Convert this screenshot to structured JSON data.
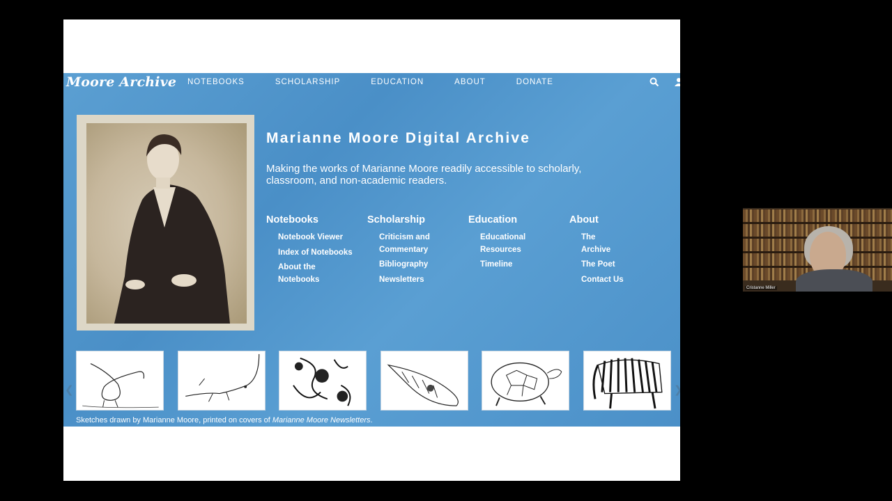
{
  "site": {
    "logo": "Moore Archive",
    "nav": [
      "NOTEBOOKS",
      "SCHOLARSHIP",
      "EDUCATION",
      "ABOUT",
      "DONATE"
    ],
    "icons": [
      "search-icon",
      "user-icon"
    ]
  },
  "hero": {
    "title": "Marianne Moore Digital Archive",
    "subtitle": "Making the works of Marianne Moore readily accessible to scholarly, classroom, and non-academic readers."
  },
  "columns": [
    {
      "heading": "Notebooks",
      "links": [
        "Notebook Viewer",
        "Index of Notebooks",
        "About the Notebooks"
      ]
    },
    {
      "heading": "Scholarship",
      "links": [
        "Criticism and Commentary",
        "Bibliography",
        "Newsletters"
      ]
    },
    {
      "heading": "Education",
      "links": [
        "Educational Resources",
        "Timeline"
      ]
    },
    {
      "heading": "About",
      "links": [
        "The Archive",
        "The Poet",
        "Contact Us"
      ]
    }
  ],
  "gallery": {
    "thumbnails": [
      "kiwi bird sketch",
      "lizard sketch",
      "figures sketch",
      "shell sketch",
      "tortoise sketch",
      "zebra sketch"
    ],
    "caption_prefix": "Sketches drawn by Marianne Moore, printed on covers of ",
    "caption_italic": "Marianne Moore Newsletters",
    "caption_suffix": "."
  },
  "video": {
    "participant_name": "Cristanne Miller"
  },
  "colors": {
    "site_blue": "#4a8fc7",
    "text": "#ffffff",
    "screen_background": "#ffffff",
    "outer_background": "#000000"
  }
}
